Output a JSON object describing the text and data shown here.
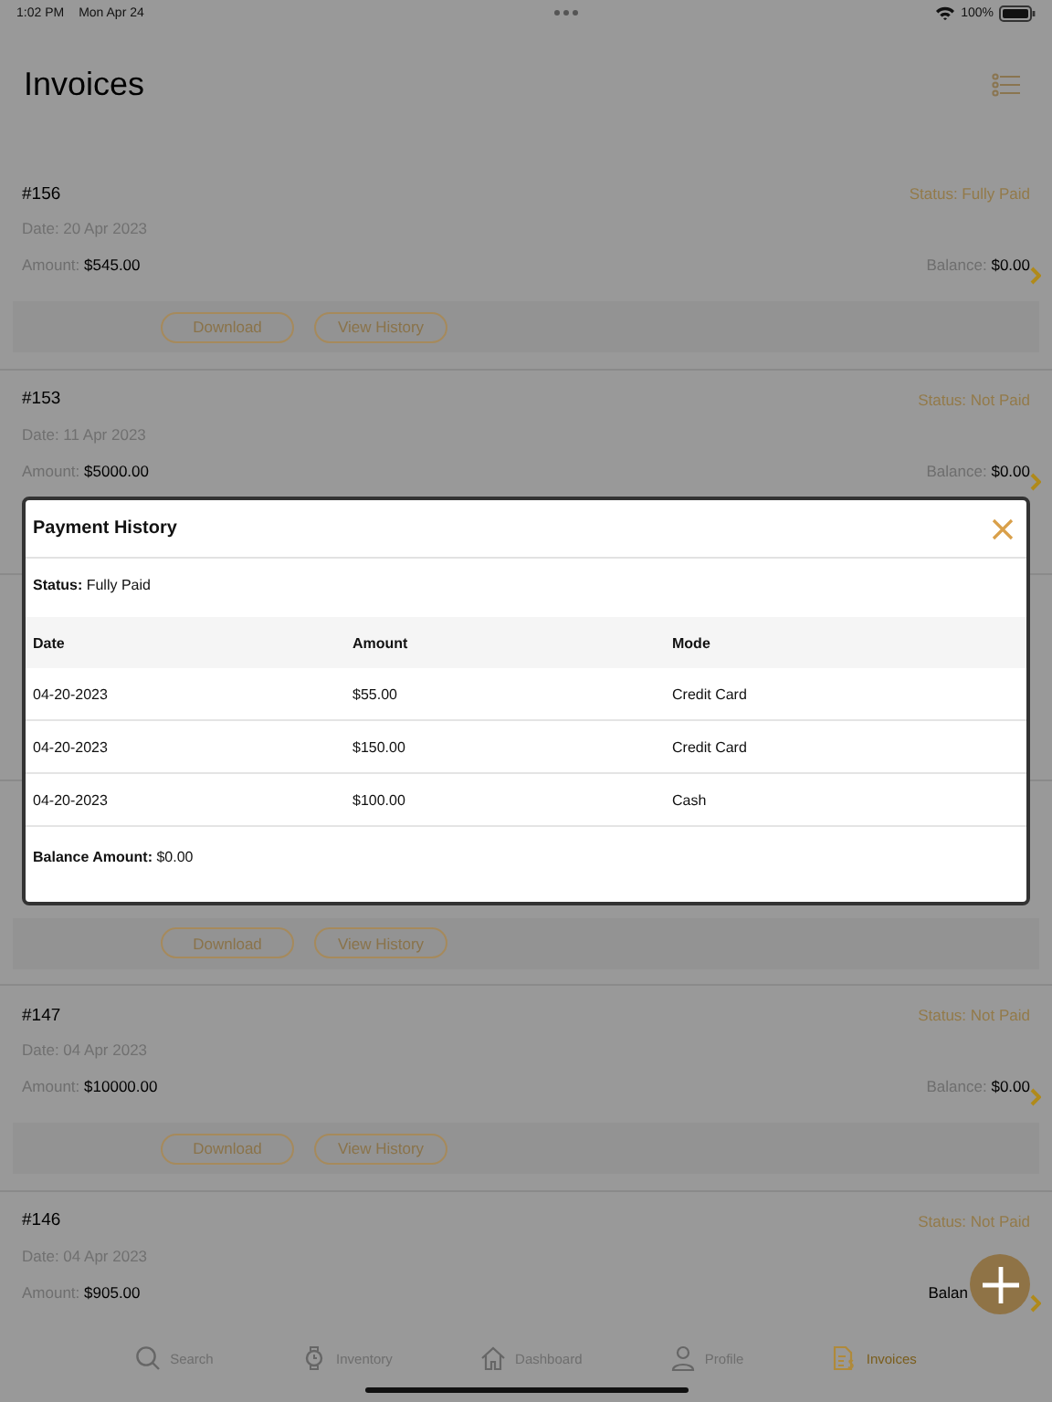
{
  "status_bar": {
    "time": "1:02 PM",
    "date": "Mon Apr 24",
    "battery": "100%"
  },
  "header": {
    "title": "Invoices"
  },
  "invoices": [
    {
      "kind": "invoice",
      "number": "#156",
      "status": "Status: Fully Paid",
      "date": "Date: 20 Apr 2023",
      "amount_label": "Amount:",
      "amount": "$545.00",
      "balance_label": "Balance:",
      "balance": "$0.00",
      "actions": [
        "Download",
        "View History"
      ]
    },
    {
      "kind": "invoice",
      "number": "#153",
      "status": "Status: Not Paid",
      "date": "Date: 11 Apr 2023",
      "amount_label": "Amount:",
      "amount": "$5000.00",
      "balance_label": "Balance:",
      "balance": "$0.00"
    },
    {
      "kind": "covered"
    },
    {
      "kind": "covered",
      "actions": [
        "Download",
        "View History"
      ]
    },
    {
      "kind": "invoice",
      "number": "#147",
      "status": "Status: Not Paid",
      "date": "Date: 04 Apr 2023",
      "amount_label": "Amount:",
      "amount": "$10000.00",
      "balance_label": "Balance:",
      "balance": "$0.00",
      "actions": [
        "Download",
        "View History"
      ]
    },
    {
      "kind": "invoice",
      "number": "#146",
      "status": "Status: Not Paid",
      "date": "Date: 04 Apr 2023",
      "amount_label": "Amount:",
      "amount": "$905.00",
      "balance_label": "Balan"
    }
  ],
  "tabs": [
    {
      "kind": "search",
      "label": "Search",
      "selected": false
    },
    {
      "kind": "watch",
      "label": "Inventory",
      "selected": false
    },
    {
      "kind": "home",
      "label": "Dashboard",
      "selected": false
    },
    {
      "kind": "person",
      "label": "Profile",
      "selected": false
    },
    {
      "kind": "document",
      "label": "Invoices",
      "selected": true
    }
  ],
  "modal": {
    "title": "Payment History",
    "status": "**Status:** Fully Paid",
    "columns": [
      "Date",
      "Amount",
      "Mode"
    ],
    "rows": [
      [
        "04-20-2023",
        "$55.00",
        "Credit Card"
      ],
      [
        "04-20-2023",
        "$150.00",
        "Credit Card"
      ],
      [
        "04-20-2023",
        "$100.00",
        "Cash"
      ]
    ],
    "balance": "**Balance Amount:** $0.00"
  }
}
